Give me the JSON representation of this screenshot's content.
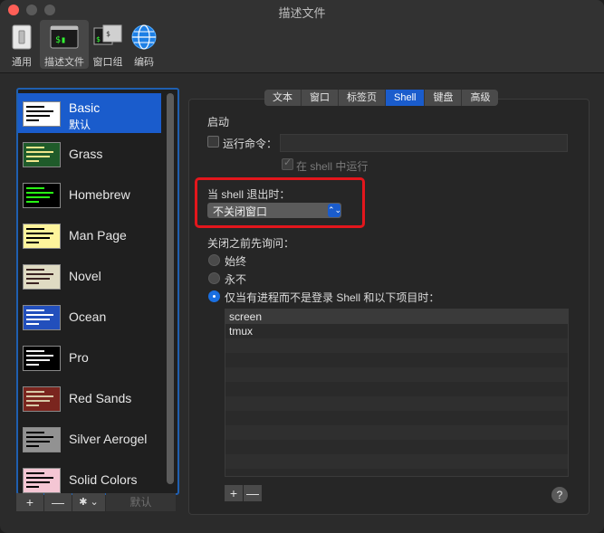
{
  "window": {
    "title": "描述文件"
  },
  "toolbar": {
    "items": [
      {
        "label": "通用",
        "icon": "switch-icon"
      },
      {
        "label": "描述文件",
        "icon": "terminal-icon"
      },
      {
        "label": "窗口组",
        "icon": "window-groups-icon"
      },
      {
        "label": "编码",
        "icon": "globe-icon"
      }
    ]
  },
  "profiles": [
    {
      "name": "Basic",
      "default_label": "默认",
      "selected": true,
      "bg": "#ffffff",
      "fg": "#000000"
    },
    {
      "name": "Grass",
      "bg": "#1f5b2a",
      "fg": "#f0e68c"
    },
    {
      "name": "Homebrew",
      "bg": "#000000",
      "fg": "#28fe14"
    },
    {
      "name": "Man Page",
      "bg": "#fef49c",
      "fg": "#000000"
    },
    {
      "name": "Novel",
      "bg": "#dfdbc3",
      "fg": "#3b2322"
    },
    {
      "name": "Ocean",
      "bg": "#224fbc",
      "fg": "#ffffff"
    },
    {
      "name": "Pro",
      "bg": "#000000",
      "fg": "#f2f2f2"
    },
    {
      "name": "Red Sands",
      "bg": "#7a251e",
      "fg": "#d7c9a7"
    },
    {
      "name": "Silver Aerogel",
      "bg": "#929292",
      "fg": "#000000"
    },
    {
      "name": "Solid Colors",
      "bg": "#f4c6d4",
      "fg": "#000000"
    }
  ],
  "list_buttons": {
    "add": "+",
    "remove": "—",
    "gear": "✱ ⌄",
    "default": "默认"
  },
  "tabs": [
    {
      "label": "文本"
    },
    {
      "label": "窗口"
    },
    {
      "label": "标签页"
    },
    {
      "label": "Shell",
      "active": true
    },
    {
      "label": "键盘"
    },
    {
      "label": "高级"
    }
  ],
  "shell": {
    "startup_heading": "启动",
    "run_command_label": "运行命令：",
    "run_command_value": "",
    "run_in_shell_label": "在 shell 中运行",
    "on_exit_label": "当 shell 退出时：",
    "on_exit_value": "不关闭窗口",
    "ask_before_closing_heading": "关闭之前先询问：",
    "ask_options": [
      {
        "label": "始终",
        "selected": false
      },
      {
        "label": "永不",
        "selected": false
      },
      {
        "label": "仅当有进程而不是登录 Shell 和以下项目时：",
        "selected": true
      }
    ],
    "process_list": [
      "screen",
      "tmux"
    ],
    "add": "+",
    "remove": "—",
    "help": "?"
  },
  "colors": {
    "accent": "#1a5ccc",
    "highlight_box": "#e3161c"
  }
}
